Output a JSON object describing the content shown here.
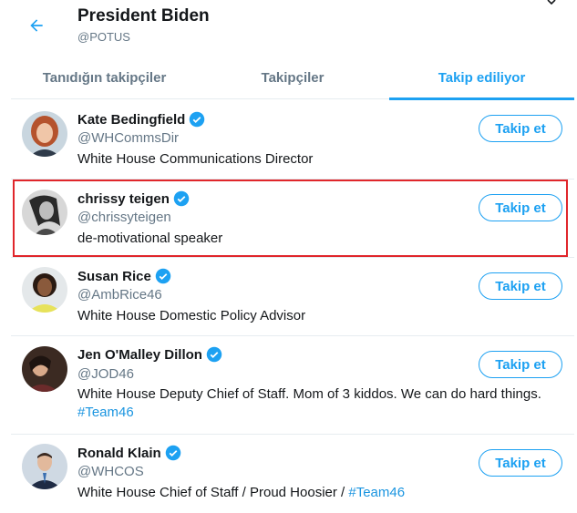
{
  "header": {
    "title": "President Biden",
    "handle": "@POTUS"
  },
  "tabs": [
    {
      "label": "Tanıdığın takipçiler",
      "active": false
    },
    {
      "label": "Takipçiler",
      "active": false
    },
    {
      "label": "Takip ediliyor",
      "active": true
    }
  ],
  "users": [
    {
      "name": "Kate Bedingfield",
      "handle": "@WHCommsDir",
      "bio": "White House Communications Director",
      "button": "Takip et",
      "avatar": "kate-bedingfield-avatar"
    },
    {
      "name": "chrissy teigen",
      "handle": "@chrissyteigen",
      "bio": "de-motivational speaker",
      "button": "Takip et",
      "avatar": "chrissy-teigen-avatar"
    },
    {
      "name": "Susan Rice",
      "handle": "@AmbRice46",
      "bio": "White House Domestic Policy Advisor",
      "button": "Takip et",
      "avatar": "susan-rice-avatar"
    },
    {
      "name": "Jen O'Malley Dillon",
      "handle": "@JOD46",
      "bio": "White House Deputy Chief of Staff. Mom of 3 kiddos. We can do hard things.",
      "bio_tag": "#Team46",
      "button": "Takip et",
      "avatar": "jen-omalley-dillon-avatar"
    },
    {
      "name": "Ronald Klain",
      "handle": "@WHCOS",
      "bio": "White House Chief of Staff / Proud Hoosier / ",
      "bio_tag": "#Team46",
      "button": "Takip et",
      "avatar": "ronald-klain-avatar"
    }
  ],
  "colors": {
    "accent": "#1da1f2",
    "highlight": "#e0262b",
    "muted": "#657786",
    "text": "#14171a"
  }
}
